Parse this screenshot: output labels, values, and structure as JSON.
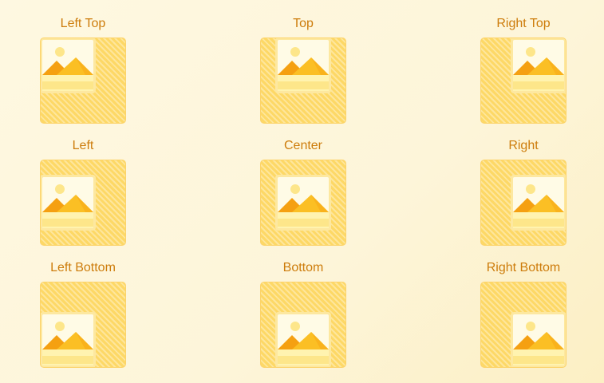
{
  "positions": [
    {
      "label": "Left Top",
      "icon": "image-placeholder-icon"
    },
    {
      "label": "Top",
      "icon": "image-placeholder-icon"
    },
    {
      "label": "Right Top",
      "icon": "image-placeholder-icon"
    },
    {
      "label": "Left",
      "icon": "image-placeholder-icon"
    },
    {
      "label": "Center",
      "icon": "image-placeholder-icon"
    },
    {
      "label": "Right",
      "icon": "image-placeholder-icon"
    },
    {
      "label": "Left Bottom",
      "icon": "image-placeholder-icon"
    },
    {
      "label": "Bottom",
      "icon": "image-placeholder-icon"
    },
    {
      "label": "Right Bottom",
      "icon": "image-placeholder-icon"
    }
  ],
  "colors": {
    "label": "#cd7c0b",
    "box": "#fdd866",
    "frame": "#fff9dc",
    "sun": "#fde68a",
    "mountain_dark": "#f5a011",
    "mountain_light": "#fbbf24",
    "ground": "#fde68a"
  }
}
